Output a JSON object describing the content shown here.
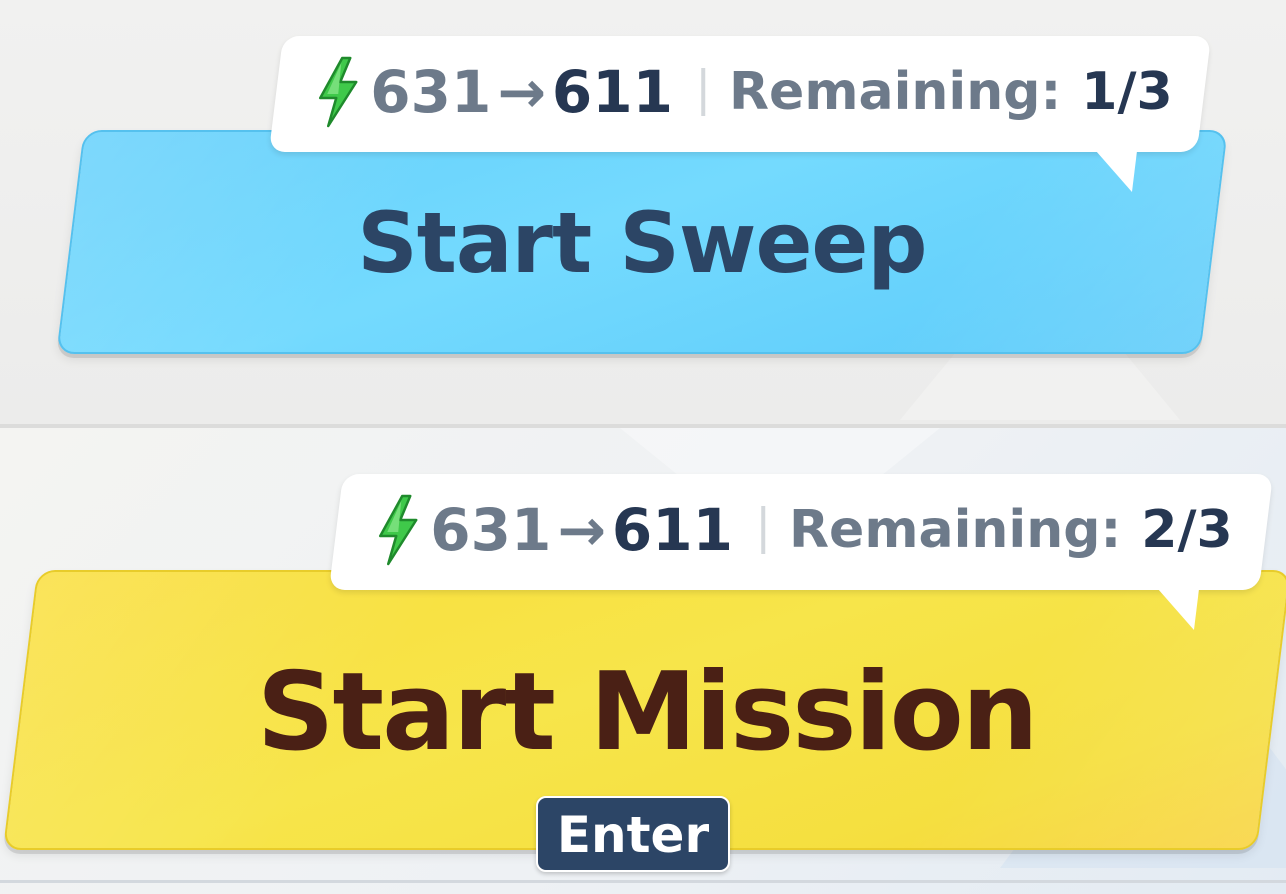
{
  "sweep": {
    "bubble": {
      "stamina_from": "631",
      "arrow": "→",
      "stamina_to": "611",
      "remaining_label": "Remaining:",
      "remaining_value": "1/3"
    },
    "button_label": "Start Sweep",
    "button_color": "#6fd6fd",
    "text_color": "#2c4565"
  },
  "mission": {
    "bubble": {
      "stamina_from": "631",
      "arrow": "→",
      "stamina_to": "611",
      "remaining_label": "Remaining:",
      "remaining_value": "2/3"
    },
    "button_label": "Start Mission",
    "button_color": "#f7e34a",
    "text_color": "#4a2015",
    "key_hint": "Enter"
  },
  "icons": {
    "stamina": "lightning-bolt-icon",
    "stamina_color": "#3fc94a"
  }
}
